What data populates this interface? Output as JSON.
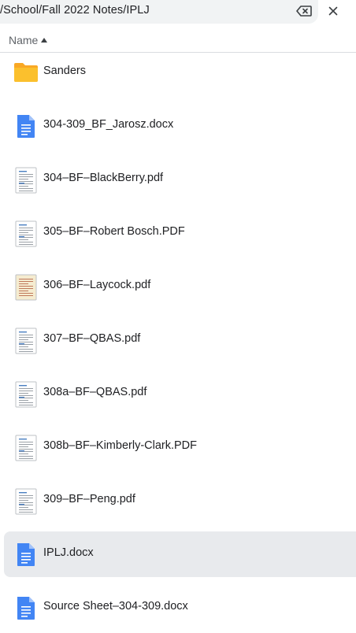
{
  "path_bar": {
    "path": "/School/Fall 2022 Notes/IPLJ"
  },
  "column_header": {
    "name_label": "Name",
    "sort": "ascending"
  },
  "files": [
    {
      "name": "Sanders",
      "type": "folder"
    },
    {
      "name": "304-309_BF_Jarosz.docx",
      "type": "docx"
    },
    {
      "name": "304–BF–BlackBerry.pdf",
      "type": "pdf"
    },
    {
      "name": "305–BF–Robert Bosch.PDF",
      "type": "pdf"
    },
    {
      "name": "306–BF–Laycock.pdf",
      "type": "pdf-yellow"
    },
    {
      "name": "307–BF–QBAS.pdf",
      "type": "pdf"
    },
    {
      "name": "308a–BF–QBAS.pdf",
      "type": "pdf"
    },
    {
      "name": "308b–BF–Kimberly-Clark.PDF",
      "type": "pdf"
    },
    {
      "name": "309–BF–Peng.pdf",
      "type": "pdf"
    },
    {
      "name": "IPLJ.docx",
      "type": "docx",
      "selected": true
    },
    {
      "name": "Source Sheet–304-309.docx",
      "type": "docx"
    }
  ],
  "icons": {
    "clear": "backspace-icon",
    "close": "close-icon",
    "folder": "folder-icon",
    "docx": "document-icon",
    "pdf": "pdf-thumbnail-icon"
  },
  "colors": {
    "folder": "#fbc02d",
    "docx": "#4285f4",
    "selected_row": "#e8eaed"
  }
}
